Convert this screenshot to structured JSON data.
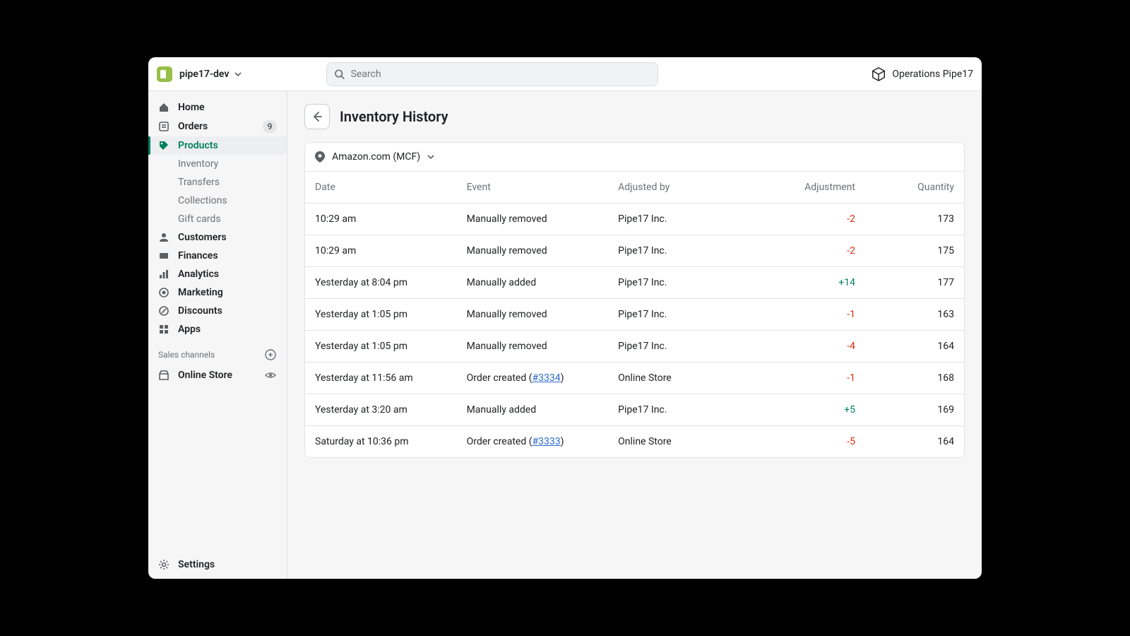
{
  "topbar": {
    "store_name": "pipe17-dev",
    "search_placeholder": "Search",
    "account_name": "Operations Pipe17"
  },
  "sidebar": {
    "home": "Home",
    "orders": "Orders",
    "orders_badge": "9",
    "products": "Products",
    "products_sub": {
      "inventory": "Inventory",
      "transfers": "Transfers",
      "collections": "Collections",
      "gift_cards": "Gift cards"
    },
    "customers": "Customers",
    "finances": "Finances",
    "analytics": "Analytics",
    "marketing": "Marketing",
    "discounts": "Discounts",
    "apps": "Apps",
    "sales_channels_label": "Sales channels",
    "online_store": "Online Store",
    "settings": "Settings"
  },
  "page": {
    "title": "Inventory History",
    "location": "Amazon.com (MCF)"
  },
  "table": {
    "columns": {
      "date": "Date",
      "event": "Event",
      "adjusted_by": "Adjusted by",
      "adjustment": "Adjustment",
      "quantity": "Quantity"
    },
    "rows": [
      {
        "date": "10:29 am",
        "event": "Manually removed",
        "order_ref": null,
        "adjusted_by": "Pipe17 Inc.",
        "adjustment": "-2",
        "adj_class": "neg",
        "quantity": "173"
      },
      {
        "date": "10:29 am",
        "event": "Manually removed",
        "order_ref": null,
        "adjusted_by": "Pipe17 Inc.",
        "adjustment": "-2",
        "adj_class": "neg",
        "quantity": "175"
      },
      {
        "date": "Yesterday at 8:04 pm",
        "event": "Manually added",
        "order_ref": null,
        "adjusted_by": "Pipe17 Inc.",
        "adjustment": "+14",
        "adj_class": "pos",
        "quantity": "177"
      },
      {
        "date": "Yesterday at 1:05 pm",
        "event": "Manually removed",
        "order_ref": null,
        "adjusted_by": "Pipe17 Inc.",
        "adjustment": "-1",
        "adj_class": "neg",
        "quantity": "163"
      },
      {
        "date": "Yesterday at 1:05 pm",
        "event": "Manually removed",
        "order_ref": null,
        "adjusted_by": "Pipe17 Inc.",
        "adjustment": "-4",
        "adj_class": "neg",
        "quantity": "164"
      },
      {
        "date": "Yesterday at 11:56 am",
        "event": "Order created",
        "order_ref": "#3334",
        "adjusted_by": "Online Store",
        "adjustment": "-1",
        "adj_class": "neg",
        "quantity": "168"
      },
      {
        "date": "Yesterday at 3:20 am",
        "event": "Manually added",
        "order_ref": null,
        "adjusted_by": "Pipe17 Inc.",
        "adjustment": "+5",
        "adj_class": "pos",
        "quantity": "169"
      },
      {
        "date": "Saturday at 10:36 pm",
        "event": "Order created",
        "order_ref": "#3333",
        "adjusted_by": "Online Store",
        "adjustment": "-5",
        "adj_class": "neg",
        "quantity": "164"
      }
    ]
  }
}
